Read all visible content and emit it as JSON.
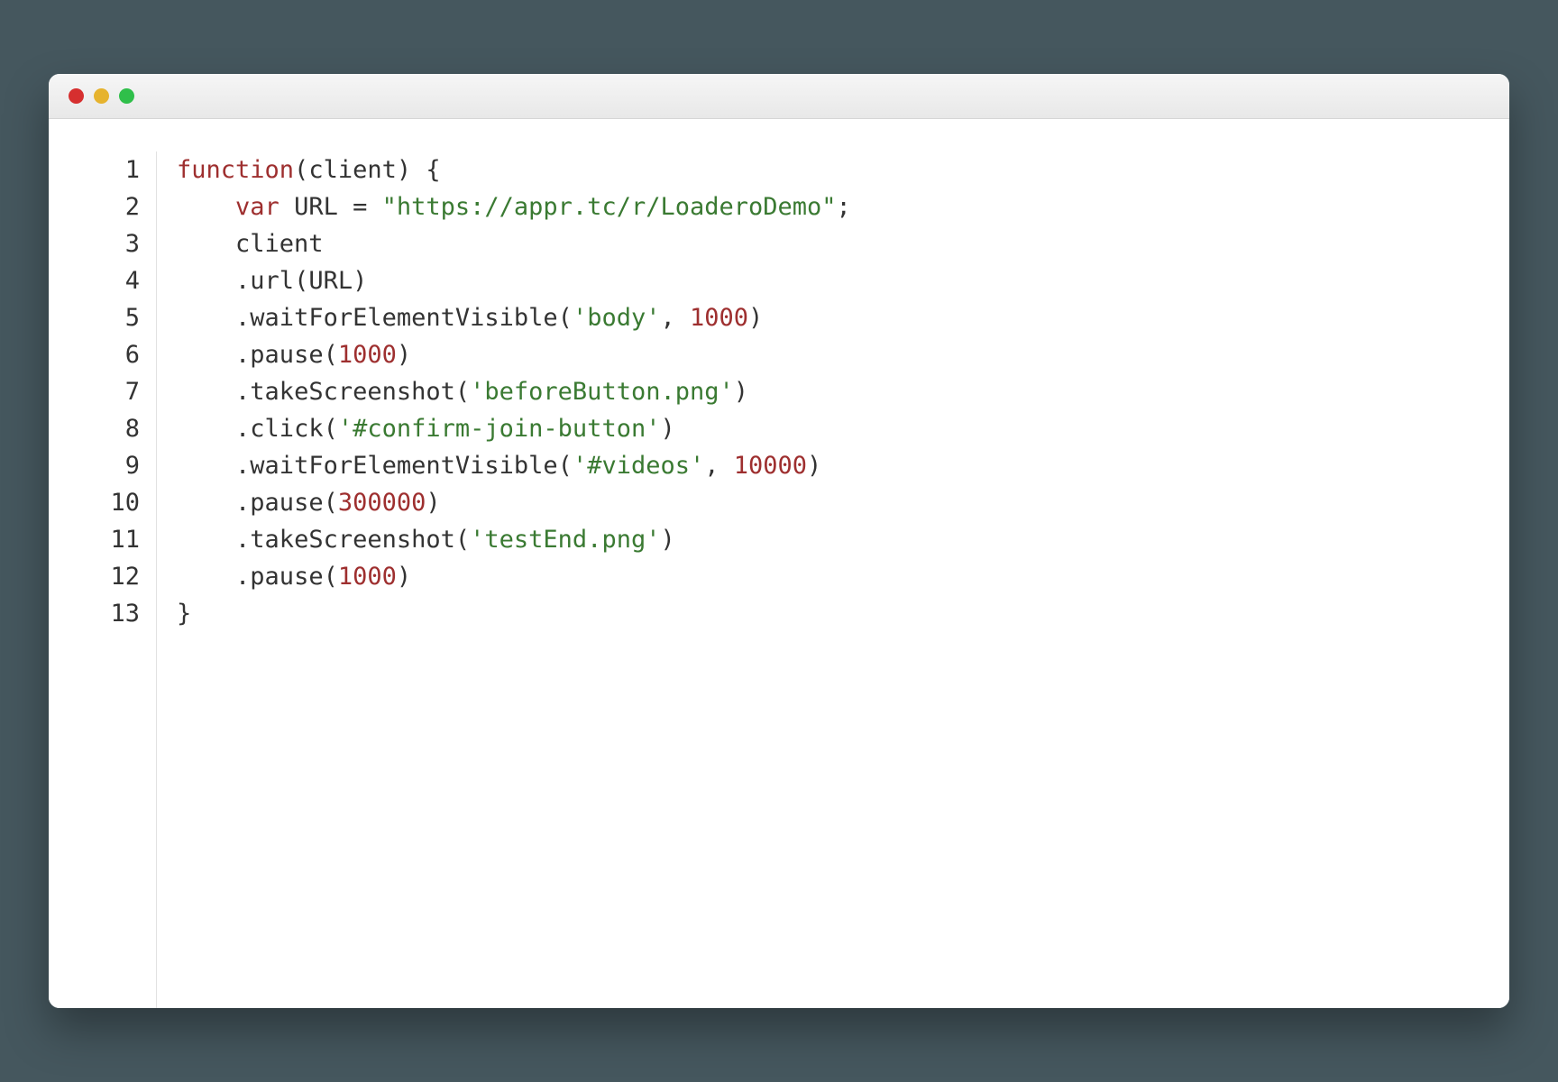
{
  "window": {
    "traffic_lights": [
      "close",
      "minimize",
      "maximize"
    ]
  },
  "editor": {
    "line_numbers": [
      "1",
      "2",
      "3",
      "4",
      "5",
      "6",
      "7",
      "8",
      "9",
      "10",
      "11",
      "12",
      "13"
    ],
    "code_lines": [
      {
        "indent": 0,
        "tokens": [
          [
            "kw-fn",
            "function"
          ],
          [
            "punct",
            "("
          ],
          [
            "ident",
            "client"
          ],
          [
            "punct",
            ") {"
          ]
        ]
      },
      {
        "indent": 1,
        "tokens": [
          [
            "kw-var",
            "var"
          ],
          [
            "ident",
            " URL "
          ],
          [
            "punct",
            "= "
          ],
          [
            "str",
            "\"https://appr.tc/r/LoaderoDemo\""
          ],
          [
            "punct",
            ";"
          ]
        ]
      },
      {
        "indent": 1,
        "tokens": [
          [
            "ident",
            "client"
          ]
        ]
      },
      {
        "indent": 1,
        "tokens": [
          [
            "punct",
            "."
          ],
          [
            "method",
            "url"
          ],
          [
            "punct",
            "("
          ],
          [
            "ident",
            "URL"
          ],
          [
            "punct",
            ")"
          ]
        ]
      },
      {
        "indent": 1,
        "tokens": [
          [
            "punct",
            "."
          ],
          [
            "method",
            "waitForElementVisible"
          ],
          [
            "punct",
            "("
          ],
          [
            "str",
            "'body'"
          ],
          [
            "punct",
            ", "
          ],
          [
            "num",
            "1000"
          ],
          [
            "punct",
            ")"
          ]
        ]
      },
      {
        "indent": 1,
        "tokens": [
          [
            "punct",
            "."
          ],
          [
            "method",
            "pause"
          ],
          [
            "punct",
            "("
          ],
          [
            "num",
            "1000"
          ],
          [
            "punct",
            ")"
          ]
        ]
      },
      {
        "indent": 1,
        "tokens": [
          [
            "punct",
            "."
          ],
          [
            "method",
            "takeScreenshot"
          ],
          [
            "punct",
            "("
          ],
          [
            "str",
            "'beforeButton.png'"
          ],
          [
            "punct",
            ")"
          ]
        ]
      },
      {
        "indent": 1,
        "tokens": [
          [
            "punct",
            "."
          ],
          [
            "method",
            "click"
          ],
          [
            "punct",
            "("
          ],
          [
            "str",
            "'#confirm-join-button'"
          ],
          [
            "punct",
            ")"
          ]
        ]
      },
      {
        "indent": 1,
        "tokens": [
          [
            "punct",
            "."
          ],
          [
            "method",
            "waitForElementVisible"
          ],
          [
            "punct",
            "("
          ],
          [
            "str",
            "'#videos'"
          ],
          [
            "punct",
            ", "
          ],
          [
            "num",
            "10000"
          ],
          [
            "punct",
            ")"
          ]
        ]
      },
      {
        "indent": 1,
        "tokens": [
          [
            "punct",
            "."
          ],
          [
            "method",
            "pause"
          ],
          [
            "punct",
            "("
          ],
          [
            "num",
            "300000"
          ],
          [
            "punct",
            ")"
          ]
        ]
      },
      {
        "indent": 1,
        "tokens": [
          [
            "punct",
            "."
          ],
          [
            "method",
            "takeScreenshot"
          ],
          [
            "punct",
            "("
          ],
          [
            "str",
            "'testEnd.png'"
          ],
          [
            "punct",
            ")"
          ]
        ]
      },
      {
        "indent": 1,
        "tokens": [
          [
            "punct",
            "."
          ],
          [
            "method",
            "pause"
          ],
          [
            "punct",
            "("
          ],
          [
            "num",
            "1000"
          ],
          [
            "punct",
            ")"
          ]
        ]
      },
      {
        "indent": 0,
        "tokens": [
          [
            "punct",
            "}"
          ]
        ]
      }
    ]
  }
}
